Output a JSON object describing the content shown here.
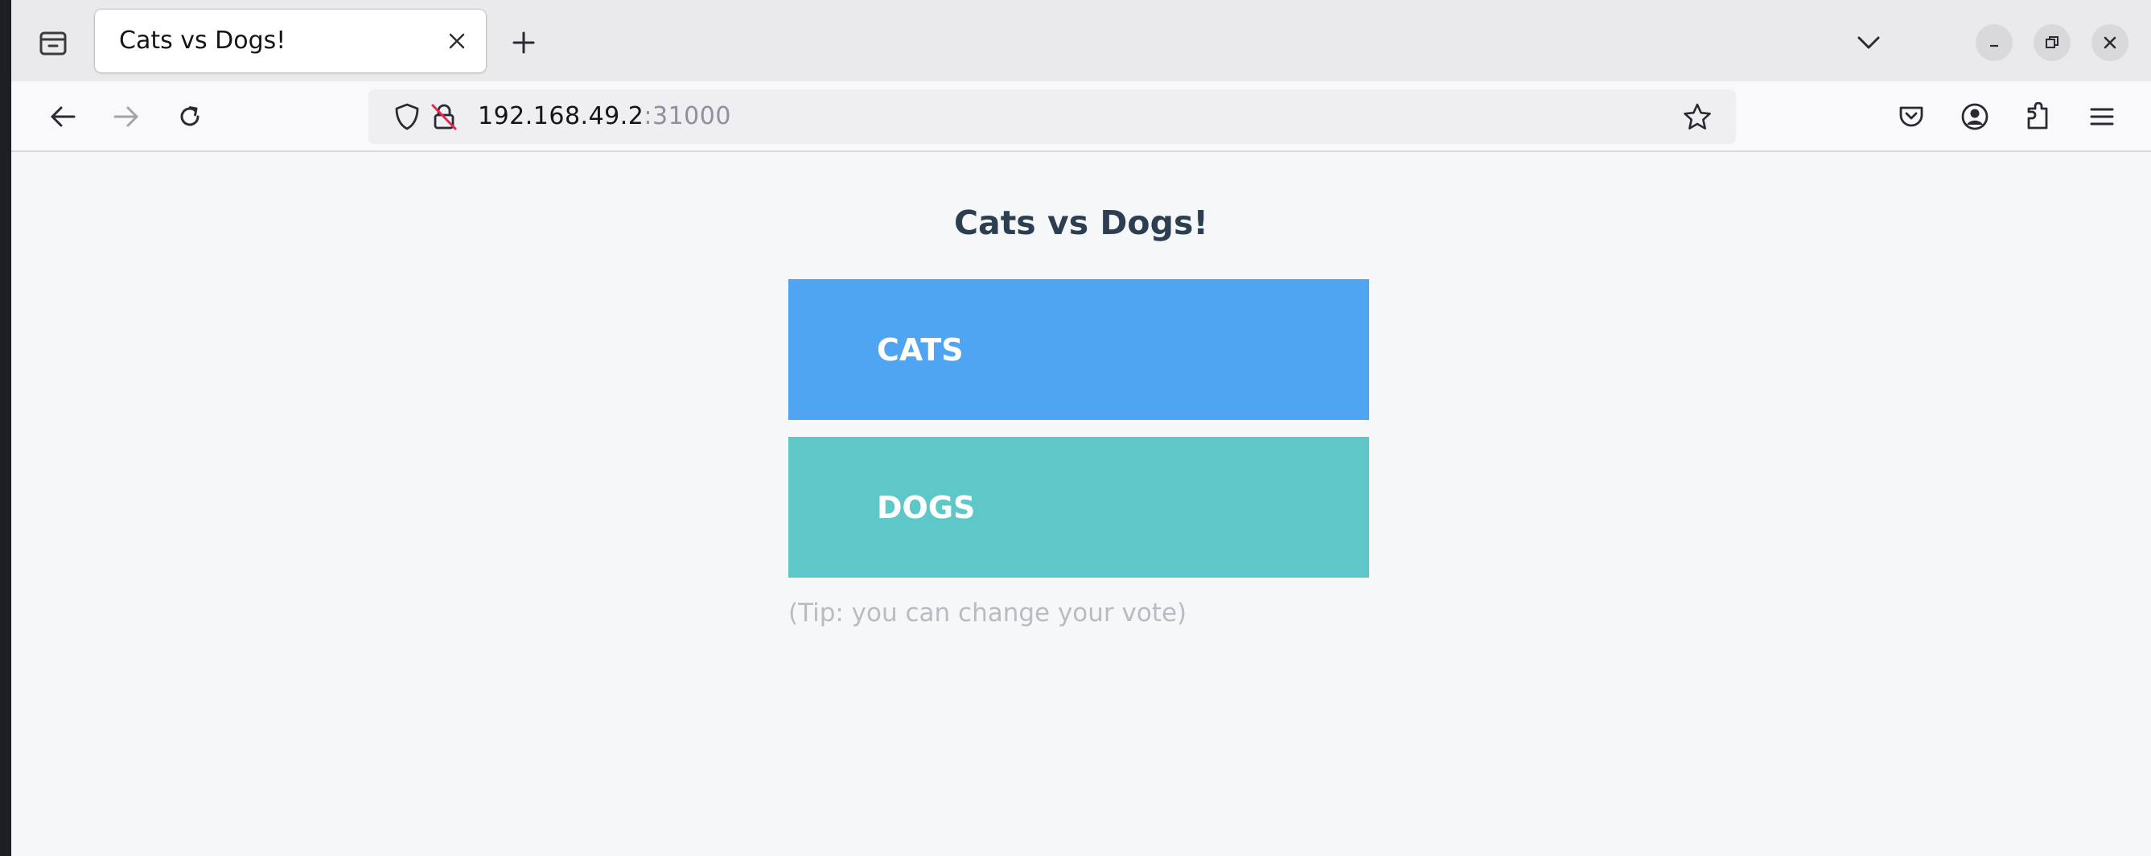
{
  "browser": {
    "tab": {
      "title": "Cats vs Dogs!"
    },
    "url": {
      "host": "192.168.49.2",
      "port": ":31000"
    }
  },
  "page": {
    "title": "Cats vs Dogs!",
    "options": [
      {
        "label": "CATS",
        "color": "#50a5f2"
      },
      {
        "label": "DOGS",
        "color": "#5ec8c8"
      }
    ],
    "tip": "(Tip: you can change your vote)"
  },
  "icons": {
    "tab_list": "tab-list-icon",
    "tab_close": "close-icon",
    "new_tab": "plus-icon",
    "tabs_dropdown": "chevron-down-icon",
    "minimize": "minimize-icon",
    "restore": "restore-icon",
    "close_window": "close-icon",
    "back": "back-arrow-icon",
    "forward": "forward-arrow-icon",
    "reload": "reload-icon",
    "tracking": "shield-icon",
    "insecure": "insecure-lock-icon",
    "bookmark": "star-icon",
    "pocket": "pocket-icon",
    "account": "account-icon",
    "extensions": "extensions-icon",
    "menu": "hamburger-menu-icon"
  }
}
